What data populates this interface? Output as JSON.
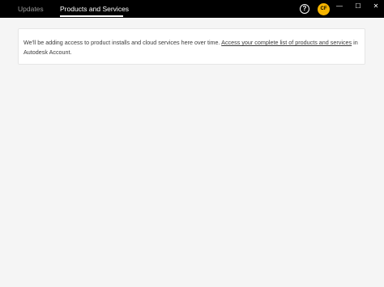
{
  "tabs": {
    "updates_label": "Updates",
    "products_label": "Products and Services"
  },
  "header": {
    "help_symbol": "?",
    "avatar_initials": "CF",
    "minimize_symbol": "—",
    "maximize_symbol": "☐",
    "close_symbol": "✕"
  },
  "notice": {
    "text_before_link": "We'll be adding access to product installs and cloud services here over time. ",
    "link_text": "Access your complete list of products and services",
    "text_after_link": " in Autodesk Account."
  },
  "colors": {
    "topbar": "#000000",
    "avatar": "#f5b400",
    "background": "#f5f5f5"
  }
}
